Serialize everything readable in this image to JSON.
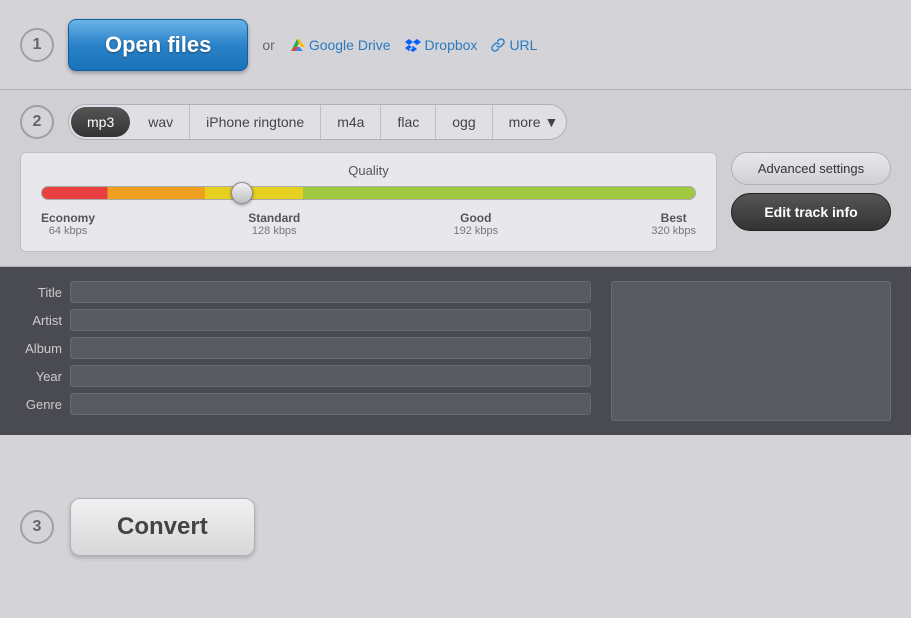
{
  "steps": {
    "step1": "1",
    "step2": "2",
    "step3": "3"
  },
  "section1": {
    "open_files_label": "Open files",
    "or_text": "or",
    "google_drive_label": "Google Drive",
    "dropbox_label": "Dropbox",
    "url_label": "URL"
  },
  "section2": {
    "tabs": [
      {
        "id": "mp3",
        "label": "mp3",
        "active": true
      },
      {
        "id": "wav",
        "label": "wav",
        "active": false
      },
      {
        "id": "iphone",
        "label": "iPhone ringtone",
        "active": false
      },
      {
        "id": "m4a",
        "label": "m4a",
        "active": false
      },
      {
        "id": "flac",
        "label": "flac",
        "active": false
      },
      {
        "id": "ogg",
        "label": "ogg",
        "active": false
      },
      {
        "id": "more",
        "label": "more",
        "active": false
      }
    ],
    "quality": {
      "label": "Quality",
      "slider_value": "30",
      "markers": [
        {
          "label": "Economy",
          "kbps": "64 kbps"
        },
        {
          "label": "Standard",
          "kbps": "128 kbps"
        },
        {
          "label": "Good",
          "kbps": "192 kbps"
        },
        {
          "label": "Best",
          "kbps": "320 kbps"
        }
      ]
    },
    "advanced_settings_label": "Advanced settings",
    "edit_track_label": "Edit track info"
  },
  "section_track": {
    "fields": [
      {
        "label": "Title",
        "placeholder": ""
      },
      {
        "label": "Artist",
        "placeholder": ""
      },
      {
        "label": "Album",
        "placeholder": ""
      },
      {
        "label": "Year",
        "placeholder": ""
      },
      {
        "label": "Genre",
        "placeholder": ""
      }
    ]
  },
  "section3": {
    "convert_label": "Convert"
  },
  "colors": {
    "accent_blue": "#2a82c8",
    "dark_tab": "#333333"
  }
}
